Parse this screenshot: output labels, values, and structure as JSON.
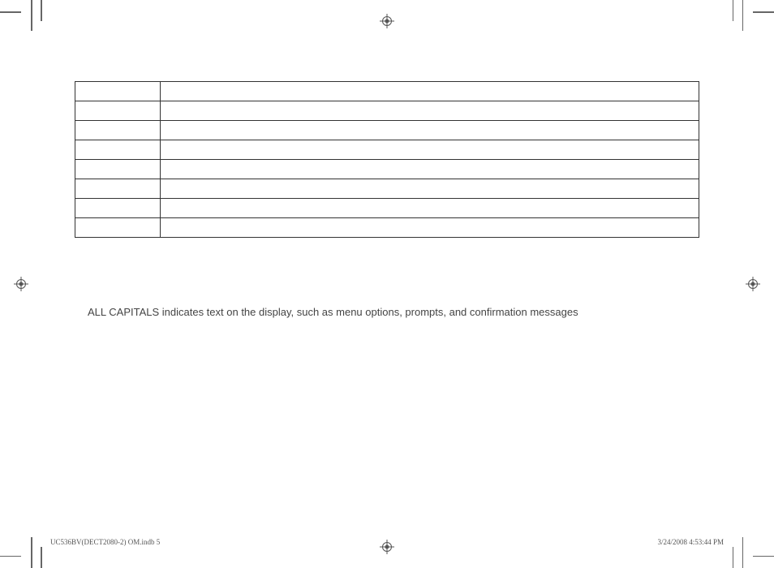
{
  "body": {
    "paragraph": "ALL CAPITALS indicates text on the display, such as menu options, prompts, and confirmation messages"
  },
  "footer": {
    "left": "UC536BV(DECT2080-2) OM.indb   5",
    "right": "3/24/2008   4:53:44 PM"
  }
}
